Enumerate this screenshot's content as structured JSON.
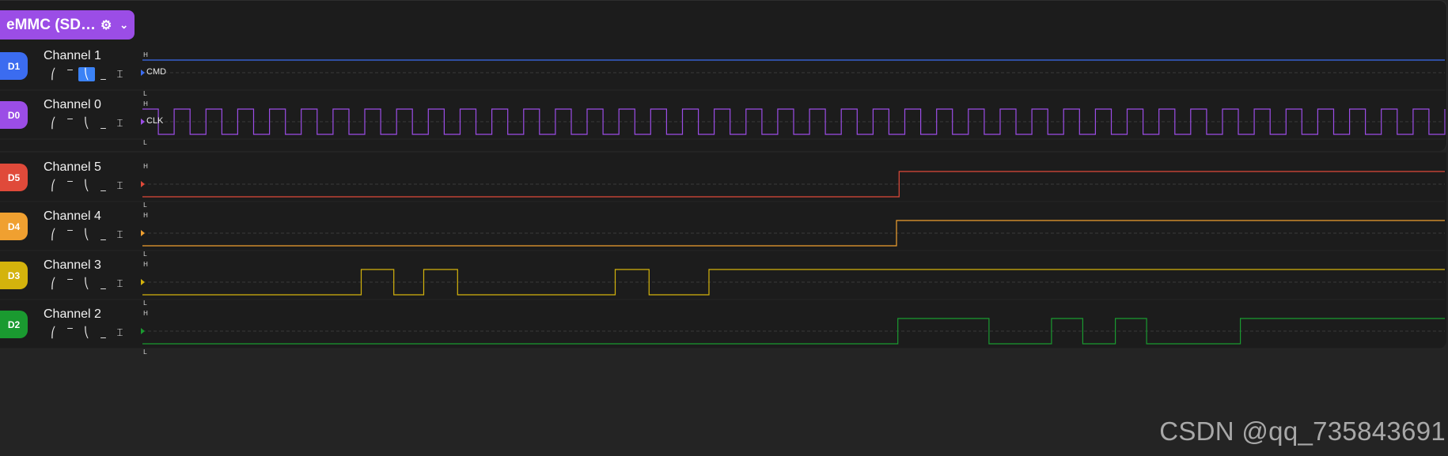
{
  "analyzer": {
    "label": "eMMC (SD…",
    "settings_icon": "gear-icon",
    "dropdown_icon": "chevron-down-icon",
    "color": "#9b4de6"
  },
  "trigger_icons": [
    "rising-edge-icon",
    "high-level-icon",
    "falling-edge-icon",
    "low-level-icon",
    "any-edge-icon"
  ],
  "trigger_glyphs": [
    "⎛",
    "‾",
    "⎝",
    "_",
    "⌶"
  ],
  "level_high": "H",
  "level_low": "L",
  "groups": [
    {
      "channels": [
        {
          "id": "D1",
          "name": "Channel 1",
          "color": "#3b6cf0",
          "signal_label": "CMD",
          "active_trigger": 2,
          "transitions": [],
          "initial": 1
        },
        {
          "id": "D0",
          "name": "Channel 0",
          "color": "#9b4de6",
          "signal_label": "CLK",
          "active_trigger": -1,
          "clock_cycles": 41,
          "initial": 1
        }
      ]
    },
    {
      "channels": [
        {
          "id": "D5",
          "name": "Channel 5",
          "color": "#e04a3a",
          "signal_label": "",
          "active_trigger": -1,
          "initial": 0,
          "transitions": [
            0.581
          ]
        },
        {
          "id": "D4",
          "name": "Channel 4",
          "color": "#f0a030",
          "signal_label": "",
          "active_trigger": -1,
          "initial": 0,
          "transitions": [
            0.579
          ]
        },
        {
          "id": "D3",
          "name": "Channel 3",
          "color": "#d4b30c",
          "signal_label": "",
          "active_trigger": -1,
          "initial": 0,
          "transitions": [
            0.168,
            0.193,
            0.216,
            0.242,
            0.363,
            0.389,
            0.435
          ]
        },
        {
          "id": "D2",
          "name": "Channel 2",
          "color": "#1a9a30",
          "signal_label": "",
          "active_trigger": -1,
          "initial": 0,
          "transitions": [
            0.58,
            0.65,
            0.698,
            0.722,
            0.747,
            0.771,
            0.843
          ]
        }
      ]
    }
  ],
  "watermark": "CSDN @qq_735843691"
}
